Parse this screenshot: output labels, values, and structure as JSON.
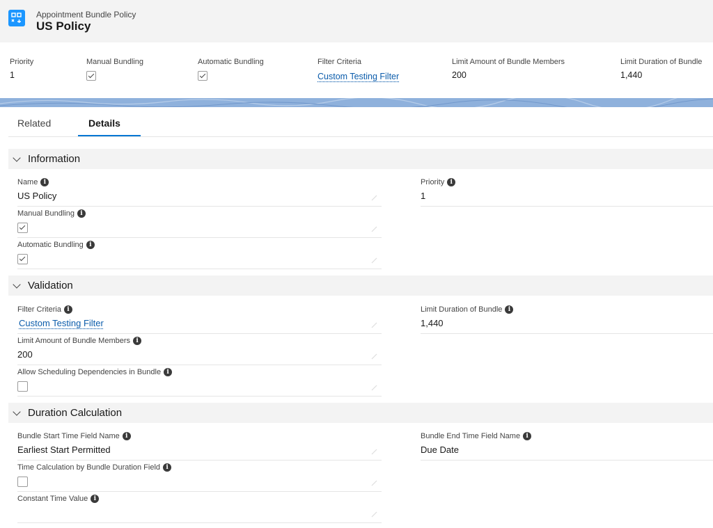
{
  "header": {
    "object_type": "Appointment Bundle Policy",
    "record_name": "US Policy"
  },
  "highlights": [
    {
      "label": "Priority",
      "value": "1",
      "kind": "text"
    },
    {
      "label": "Manual Bundling",
      "kind": "checkbox",
      "checked": true
    },
    {
      "label": "Automatic Bundling",
      "kind": "checkbox",
      "checked": true
    },
    {
      "label": "Filter Criteria",
      "value": "Custom Testing Filter",
      "kind": "link"
    },
    {
      "label": "Limit Amount of Bundle Members",
      "value": "200",
      "kind": "text"
    },
    {
      "label": "Limit Duration of Bundle",
      "value": "1,440",
      "kind": "text"
    }
  ],
  "tabs": [
    {
      "label": "Related",
      "active": false
    },
    {
      "label": "Details",
      "active": true
    }
  ],
  "sections": {
    "information": {
      "title": "Information",
      "name": {
        "label": "Name",
        "value": "US Policy"
      },
      "priority": {
        "label": "Priority",
        "value": "1"
      },
      "manual_bundling": {
        "label": "Manual Bundling",
        "checked": true
      },
      "automatic_bundling": {
        "label": "Automatic Bundling",
        "checked": true
      }
    },
    "validation": {
      "title": "Validation",
      "filter_criteria": {
        "label": "Filter Criteria",
        "value": "Custom Testing Filter"
      },
      "limit_duration": {
        "label": "Limit Duration of Bundle",
        "value": "1,440"
      },
      "limit_amount": {
        "label": "Limit Amount of Bundle Members",
        "value": "200"
      },
      "allow_sched": {
        "label": "Allow Scheduling Dependencies in Bundle",
        "checked": false
      }
    },
    "duration": {
      "title": "Duration Calculation",
      "bundle_start": {
        "label": "Bundle Start Time Field Name",
        "value": "Earliest Start Permitted"
      },
      "bundle_end": {
        "label": "Bundle End Time Field Name",
        "value": "Due Date"
      },
      "time_calc": {
        "label": "Time Calculation by Bundle Duration Field",
        "checked": false
      },
      "constant_time": {
        "label": "Constant Time Value",
        "value": ""
      }
    }
  },
  "icons": {
    "object": "bundle-policy-icon",
    "info": "info-icon",
    "edit": "pencil-icon",
    "collapse": "chevron-down-icon"
  },
  "colors": {
    "accent": "#0176d3",
    "link": "#0b5cab",
    "object_icon": "#1b96ff",
    "header_bg": "#f3f3f3"
  }
}
